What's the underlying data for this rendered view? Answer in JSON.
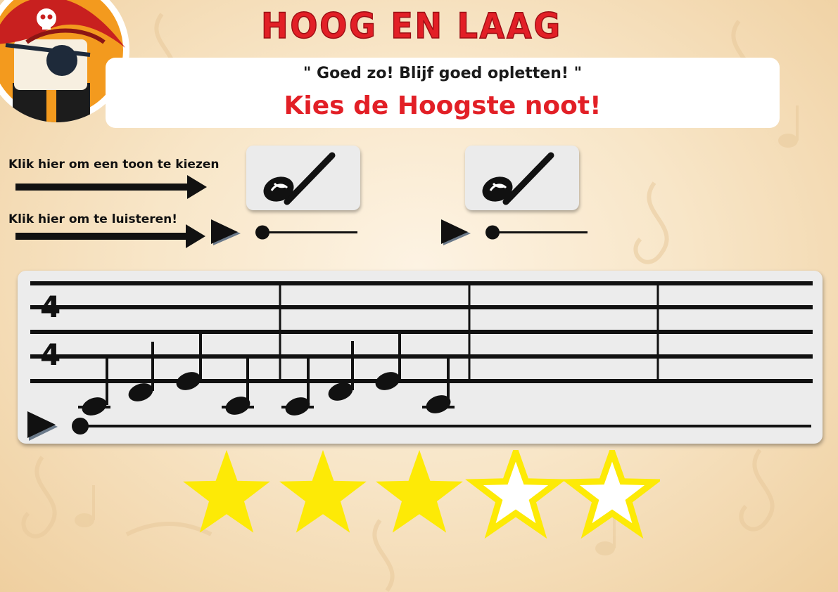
{
  "title": "HOOG EN LAAG",
  "feedback": "\" Goed zo! Blijf goed opletten! \"",
  "instruction": "Kies de Hoogste noot!",
  "hints": {
    "choose": "Klik hier om een toon te kiezen",
    "listen": "Klik hier om te luisteren!"
  },
  "staff": {
    "time_signature": {
      "top": "4",
      "bottom": "4"
    }
  },
  "rating": {
    "earned": 3,
    "total": 5
  },
  "colors": {
    "title_red": "#e21f26",
    "star_fill": "#fdea06",
    "star_outline": "#fdea06"
  },
  "icons": {
    "choice": "note-check-icon",
    "play": "play-icon",
    "avatar": "pirate-avatar"
  }
}
